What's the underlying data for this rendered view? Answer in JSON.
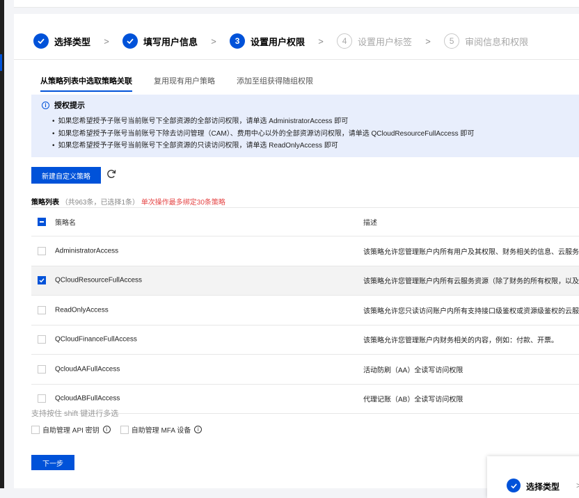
{
  "steps": [
    {
      "num": "1",
      "label": "选择类型",
      "state": "done"
    },
    {
      "num": "2",
      "label": "填写用户信息",
      "state": "done"
    },
    {
      "num": "3",
      "label": "设置用户权限",
      "state": "current"
    },
    {
      "num": "4",
      "label": "设置用户标签",
      "state": "todo"
    },
    {
      "num": "5",
      "label": "审阅信息和权限",
      "state": "todo"
    }
  ],
  "step_separator": ">",
  "tabs": [
    "从策略列表中选取策略关联",
    "复用现有用户策略",
    "添加至组获得随组权限"
  ],
  "notice": {
    "title": "授权提示",
    "icon_glyph": "i",
    "lines": [
      "如果您希望授予子账号当前账号下全部资源的全部访问权限，请单选 AdministratorAccess 即可",
      "如果您希望授予子账号当前账号下除去访问管理（CAM）、费用中心以外的全部资源访问权限，请单选 QCloudResourceFullAccess 即可",
      "如果您希望授予子账号当前账号下全部资源的只读访问权限，请单选 ReadOnlyAccess 即可"
    ]
  },
  "new_policy_button": "新建自定义策略",
  "list_header": {
    "title": "策略列表",
    "count": "（共963条，已选择1条）",
    "warning": "单次操作最多绑定30条策略"
  },
  "table": {
    "columns": [
      "策略名",
      "描述"
    ],
    "rows": [
      {
        "name": "AdministratorAccess",
        "desc": "该策略允许您管理账户内所有用户及其权限、财务相关的信息、云服务资产",
        "checked": false
      },
      {
        "name": "QCloudResourceFullAccess",
        "desc": "该策略允许您管理账户内所有云服务资源（除了财务的所有权限，以及CAM",
        "checked": true
      },
      {
        "name": "ReadOnlyAccess",
        "desc": "该策略允许您只读访问账户内所有支持接口级鉴权或资源级鉴权的云服务资",
        "checked": false
      },
      {
        "name": "QCloudFinanceFullAccess",
        "desc": "该策略允许您管理账户内财务相关的内容，例如：付款、开票。",
        "checked": false
      },
      {
        "name": "QcloudAAFullAccess",
        "desc": "活动防刷（AA）全读写访问权限",
        "checked": false
      },
      {
        "name": "QcloudABFullAccess",
        "desc": "代理记账（AB）全读写访问权限",
        "checked": false
      }
    ]
  },
  "shift_hint": "支持按住 shift 键进行多选",
  "options": [
    {
      "label": "自助管理 API 密钥",
      "help": "i"
    },
    {
      "label": "自助管理 MFA 设备",
      "help": "i"
    }
  ],
  "next_button": "下一步",
  "popup_step": {
    "label": "选择类型",
    "next": ">"
  },
  "colors": {
    "accent": "#0052d9",
    "warning": "#e54545"
  }
}
